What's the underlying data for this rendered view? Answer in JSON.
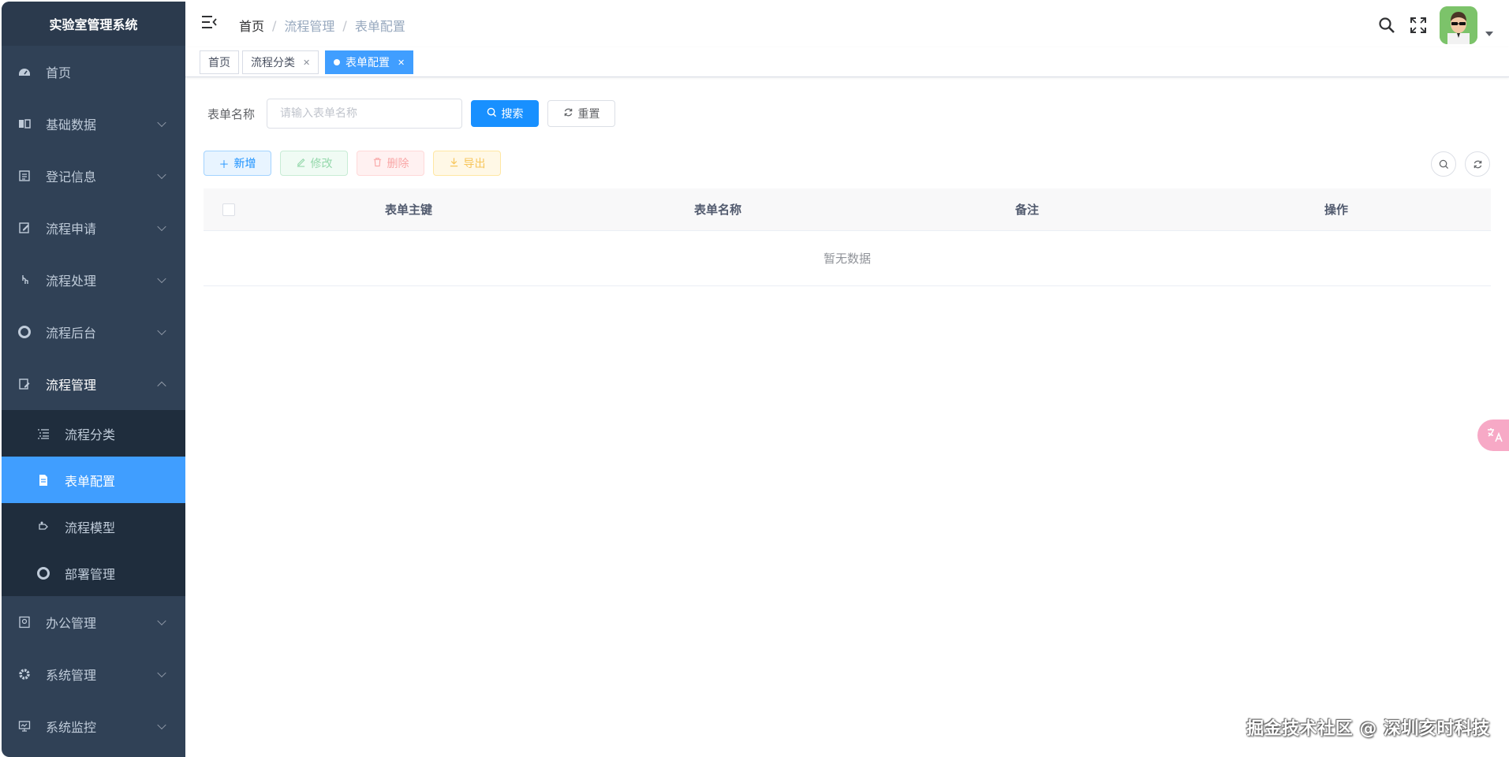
{
  "app": {
    "title": "实验室管理系统"
  },
  "sidebar": {
    "items": [
      {
        "label": "首页",
        "icon": "dashboard-icon",
        "expandable": false
      },
      {
        "label": "基础数据",
        "icon": "book-icon",
        "expandable": true
      },
      {
        "label": "登记信息",
        "icon": "register-icon",
        "expandable": true
      },
      {
        "label": "流程申请",
        "icon": "edit-icon",
        "expandable": true
      },
      {
        "label": "流程处理",
        "icon": "hand-icon",
        "expandable": true
      },
      {
        "label": "流程后台",
        "icon": "lifebuoy-icon",
        "expandable": true
      },
      {
        "label": "流程管理",
        "icon": "form-edit-icon",
        "expandable": true,
        "open": true
      },
      {
        "label": "办公管理",
        "icon": "office-icon",
        "expandable": true
      },
      {
        "label": "系统管理",
        "icon": "gear-icon",
        "expandable": true
      },
      {
        "label": "系统监控",
        "icon": "monitor-icon",
        "expandable": true
      }
    ],
    "submenu": [
      {
        "label": "流程分类",
        "icon": "list-icon"
      },
      {
        "label": "表单配置",
        "icon": "document-icon",
        "active": true
      },
      {
        "label": "流程模型",
        "icon": "model-icon"
      },
      {
        "label": "部署管理",
        "icon": "lifebuoy-icon"
      }
    ]
  },
  "header": {
    "breadcrumb": [
      "首页",
      "流程管理",
      "表单配置"
    ],
    "separator": "/"
  },
  "tags": [
    {
      "label": "首页",
      "closable": false
    },
    {
      "label": "流程分类",
      "closable": true
    },
    {
      "label": "表单配置",
      "closable": true,
      "active": true
    }
  ],
  "search": {
    "label": "表单名称",
    "placeholder": "请输入表单名称",
    "value": "",
    "search_label": "搜索",
    "reset_label": "重置"
  },
  "toolbar": {
    "add_label": "新增",
    "edit_label": "修改",
    "delete_label": "删除",
    "export_label": "导出"
  },
  "table": {
    "columns": [
      "表单主键",
      "表单名称",
      "备注",
      "操作"
    ],
    "rows": [],
    "empty_text": "暂无数据"
  },
  "watermark": "掘金技术社区 @ 深圳亥时科技",
  "colors": {
    "sidebar_bg": "#304156",
    "submenu_bg": "#1f2d3d",
    "primary": "#1890ff",
    "active_menu": "#409eff"
  }
}
